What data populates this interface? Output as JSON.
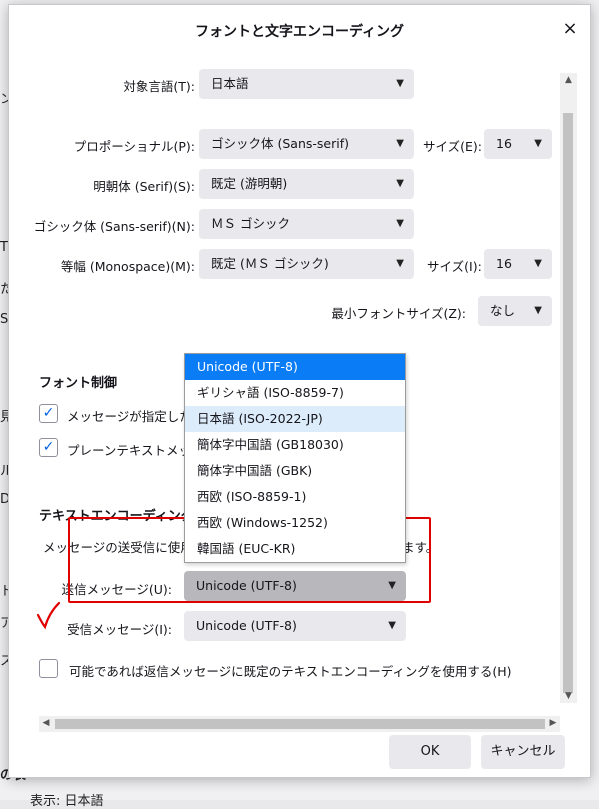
{
  "background": {
    "fragments": [
      "ン",
      "T",
      "た",
      "S",
      "見",
      "ル",
      "D",
      "ト",
      "ア",
      "ス",
      "の表",
      "表示: 日本語"
    ]
  },
  "dialog": {
    "title": "フォントと文字エンコーディング",
    "close_label": "×"
  },
  "fonts": {
    "target_language": {
      "label": "対象言語(T):",
      "value": "日本語"
    },
    "proportional": {
      "label": "プロポーショナル(P):",
      "value": "ゴシック体 (Sans-serif)"
    },
    "proportional_size": {
      "label": "サイズ(E):",
      "value": "16"
    },
    "serif": {
      "label": "明朝体 (Serif)(S):",
      "value": "既定 (游明朝)"
    },
    "sans_serif": {
      "label": "ゴシック体 (Sans-serif)(N):",
      "value": "ＭＳ ゴシック"
    },
    "monospace": {
      "label": "等幅 (Monospace)(M):",
      "value": "既定 (ＭＳ ゴシック)"
    },
    "monospace_size": {
      "label": "サイズ(I):",
      "value": "16"
    },
    "min_size": {
      "label": "最小フォントサイズ(Z):",
      "value": "なし"
    }
  },
  "font_control": {
    "title": "フォント制御",
    "opt1": "メッセージが指定したフ",
    "opt2": "プレーンテキストメッセー"
  },
  "text_encoding": {
    "title": "テキストエンコーディング",
    "desc_left": "メッセージの送受信に使用す",
    "desc_right": "ます。",
    "outgoing": {
      "label": "送信メッセージ(U):",
      "value": "Unicode (UTF-8)"
    },
    "incoming": {
      "label": "受信メッセージ(I):",
      "value": "Unicode (UTF-8)"
    },
    "reply_default": "可能であれば返信メッセージに既定のテキストエンコーディングを使用する(H)"
  },
  "dropdown_options": [
    "Unicode (UTF-8)",
    "ギリシャ語 (ISO-8859-7)",
    "日本語 (ISO-2022-JP)",
    "簡体字中国語 (GB18030)",
    "簡体字中国語 (GBK)",
    "西欧 (ISO-8859-1)",
    "西欧 (Windows-1252)",
    "韓国語 (EUC-KR)"
  ],
  "buttons": {
    "ok": "OK",
    "cancel": "キャンセル"
  },
  "colors": {
    "highlight": "#0a7cf5",
    "hover": "#dcecfb",
    "annotation_red": "#e00000",
    "check_blue": "#0061e0"
  },
  "icons": {
    "chevron": "chevron-down-icon",
    "checkmark": "checkmark-icon"
  }
}
